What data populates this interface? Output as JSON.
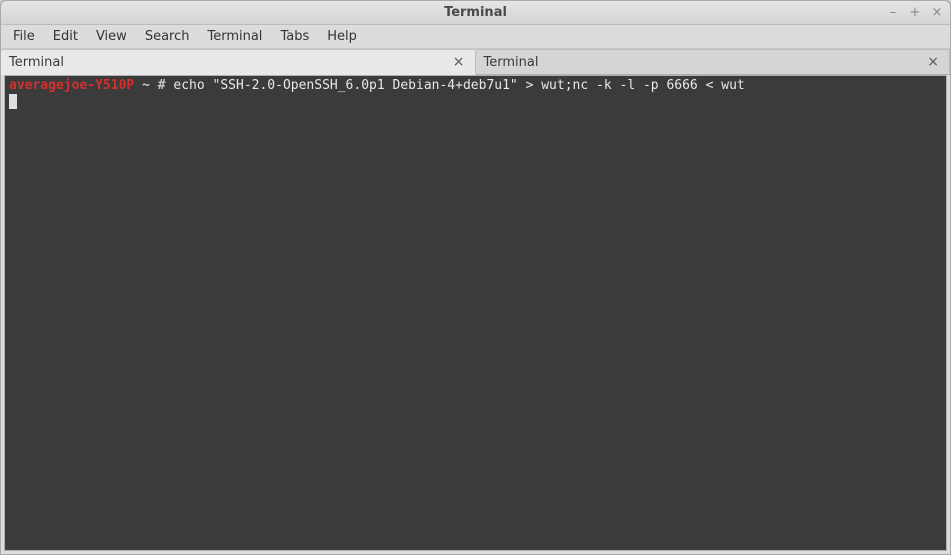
{
  "window": {
    "title": "Terminal"
  },
  "titlebar_controls": {
    "minimize": "–",
    "maximize": "+",
    "close": "×"
  },
  "menubar": {
    "file": "File",
    "edit": "Edit",
    "view": "View",
    "search": "Search",
    "terminal": "Terminal",
    "tabs": "Tabs",
    "help": "Help"
  },
  "tabs": [
    {
      "label": "Terminal",
      "active": true
    },
    {
      "label": "Terminal",
      "active": false
    }
  ],
  "tab_close": "×",
  "terminal": {
    "prompt_host": "averagejoe-Y510P",
    "prompt_path": "~",
    "prompt_symbol": "#",
    "command": "echo \"SSH-2.0-OpenSSH_6.0p1 Debian-4+deb7u1\" > wut;nc -k -l -p 6666 < wut"
  }
}
